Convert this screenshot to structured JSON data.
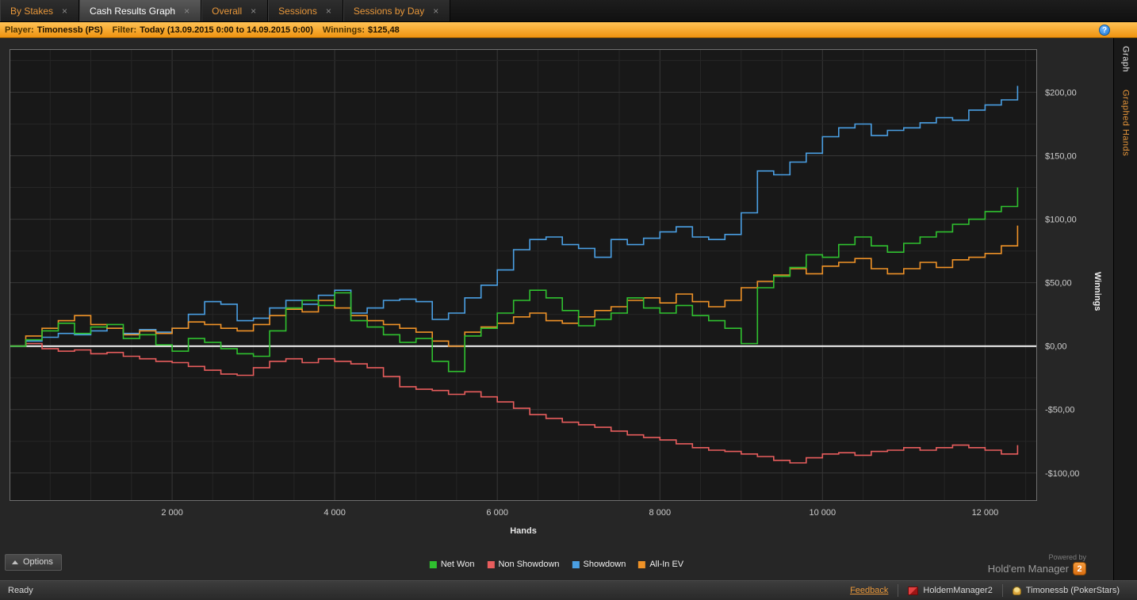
{
  "tabs": [
    {
      "label": "By Stakes",
      "close": "×",
      "active": false
    },
    {
      "label": "Cash Results Graph",
      "close": "×",
      "active": true
    },
    {
      "label": "Overall",
      "close": "×",
      "active": false
    },
    {
      "label": "Sessions",
      "close": "×",
      "active": false
    },
    {
      "label": "Sessions by Day",
      "close": "×",
      "active": false
    }
  ],
  "filter_bar": {
    "player_label": "Player:",
    "player_value": "Timonessb (PS)",
    "filter_label": "Filter:",
    "filter_value": "Today (13.09.2015 0:00 to 14.09.2015 0:00)",
    "winnings_label": "Winnings:",
    "winnings_value": "$125,48",
    "help_icon": "?"
  },
  "chart_data": {
    "type": "line",
    "xlabel": "Hands",
    "ylabel": "Winnings",
    "xlim": [
      0,
      12640
    ],
    "ylim": [
      -122,
      234
    ],
    "grid": true,
    "legend_position": "bottom",
    "x_ticks": [
      {
        "value": 2000,
        "label": "2 000"
      },
      {
        "value": 4000,
        "label": "4 000"
      },
      {
        "value": 6000,
        "label": "6 000"
      },
      {
        "value": 8000,
        "label": "8 000"
      },
      {
        "value": 10000,
        "label": "10 000"
      },
      {
        "value": 12000,
        "label": "12 000"
      }
    ],
    "y_ticks": [
      {
        "value": 200,
        "label": "$200,00"
      },
      {
        "value": 150,
        "label": "$150,00"
      },
      {
        "value": 100,
        "label": "$100,00"
      },
      {
        "value": 50,
        "label": "$50,00"
      },
      {
        "value": 0,
        "label": "$0,00"
      },
      {
        "value": -50,
        "label": "-$50,00"
      },
      {
        "value": -100,
        "label": "-$100,00"
      }
    ],
    "x": [
      0,
      200,
      400,
      600,
      800,
      1000,
      1200,
      1400,
      1600,
      1800,
      2000,
      2200,
      2400,
      2600,
      2800,
      3000,
      3200,
      3400,
      3600,
      3800,
      4000,
      4200,
      4400,
      4600,
      4800,
      5000,
      5200,
      5400,
      5600,
      5800,
      6000,
      6200,
      6400,
      6600,
      6800,
      7000,
      7200,
      7400,
      7600,
      7800,
      8000,
      8200,
      8400,
      8600,
      8800,
      9000,
      9200,
      9400,
      9600,
      9800,
      10000,
      10200,
      10400,
      10600,
      10800,
      11000,
      11200,
      11400,
      11600,
      11800,
      12000,
      12200,
      12400
    ],
    "series": [
      {
        "name": "Net Won",
        "color": "#2fc12f",
        "z": 4,
        "values": [
          0,
          5,
          12,
          18,
          10,
          15,
          17,
          6,
          9,
          1,
          -4,
          6,
          3,
          -2,
          -6,
          -8,
          12,
          30,
          36,
          32,
          42,
          20,
          15,
          9,
          3,
          6,
          -12,
          -20,
          8,
          14,
          26,
          36,
          44,
          38,
          28,
          16,
          21,
          26,
          38,
          30,
          26,
          32,
          24,
          20,
          14,
          2,
          46,
          55,
          62,
          72,
          70,
          80,
          86,
          79,
          74,
          81,
          86,
          90,
          96,
          100,
          106,
          110,
          125
        ]
      },
      {
        "name": "Non Showdown",
        "color": "#e85d5d",
        "z": 1,
        "values": [
          0,
          2,
          -2,
          -4,
          -3,
          -6,
          -5,
          -8,
          -10,
          -12,
          -13,
          -16,
          -19,
          -22,
          -23,
          -17,
          -12,
          -10,
          -13,
          -10,
          -12,
          -14,
          -17,
          -24,
          -32,
          -34,
          -35,
          -38,
          -36,
          -40,
          -44,
          -49,
          -54,
          -57,
          -60,
          -62,
          -64,
          -67,
          -70,
          -72,
          -74,
          -77,
          -80,
          -82,
          -83,
          -85,
          -87,
          -90,
          -92,
          -88,
          -85,
          -84,
          -86,
          -83,
          -82,
          -80,
          -82,
          -80,
          -78,
          -80,
          -82,
          -85,
          -78
        ]
      },
      {
        "name": "Showdown",
        "color": "#4a9fe3",
        "z": 2,
        "values": [
          0,
          4,
          7,
          10,
          9,
          12,
          14,
          10,
          13,
          11,
          14,
          25,
          35,
          33,
          20,
          22,
          30,
          36,
          33,
          40,
          44,
          26,
          30,
          36,
          37,
          35,
          21,
          26,
          38,
          48,
          60,
          76,
          84,
          86,
          80,
          77,
          70,
          84,
          80,
          85,
          90,
          94,
          86,
          84,
          88,
          105,
          138,
          135,
          145,
          152,
          165,
          172,
          175,
          166,
          170,
          172,
          176,
          180,
          178,
          186,
          190,
          194,
          205
        ]
      },
      {
        "name": "All-In EV",
        "color": "#ef9227",
        "z": 3,
        "values": [
          0,
          8,
          14,
          20,
          24,
          17,
          14,
          9,
          12,
          10,
          14,
          19,
          17,
          14,
          12,
          17,
          24,
          29,
          27,
          36,
          30,
          24,
          20,
          17,
          14,
          11,
          4,
          0,
          11,
          15,
          18,
          23,
          26,
          20,
          18,
          23,
          28,
          31,
          36,
          38,
          34,
          41,
          35,
          31,
          36,
          46,
          51,
          56,
          61,
          57,
          63,
          66,
          69,
          61,
          57,
          61,
          66,
          62,
          68,
          70,
          73,
          79,
          95
        ]
      }
    ],
    "zero_line_color": "#f5f5f5"
  },
  "sidebar": {
    "items": [
      {
        "label": "Graph",
        "active": true
      },
      {
        "label": "Graphed Hands",
        "active": false
      }
    ]
  },
  "options_label": "Options",
  "powered_by": {
    "line1": "Powered by",
    "line2": "Hold'em Manager",
    "badge": "2"
  },
  "status_bar": {
    "ready": "Ready",
    "feedback": "Feedback",
    "app": "HoldemManager2",
    "account": "Timonessb (PokerStars)"
  }
}
